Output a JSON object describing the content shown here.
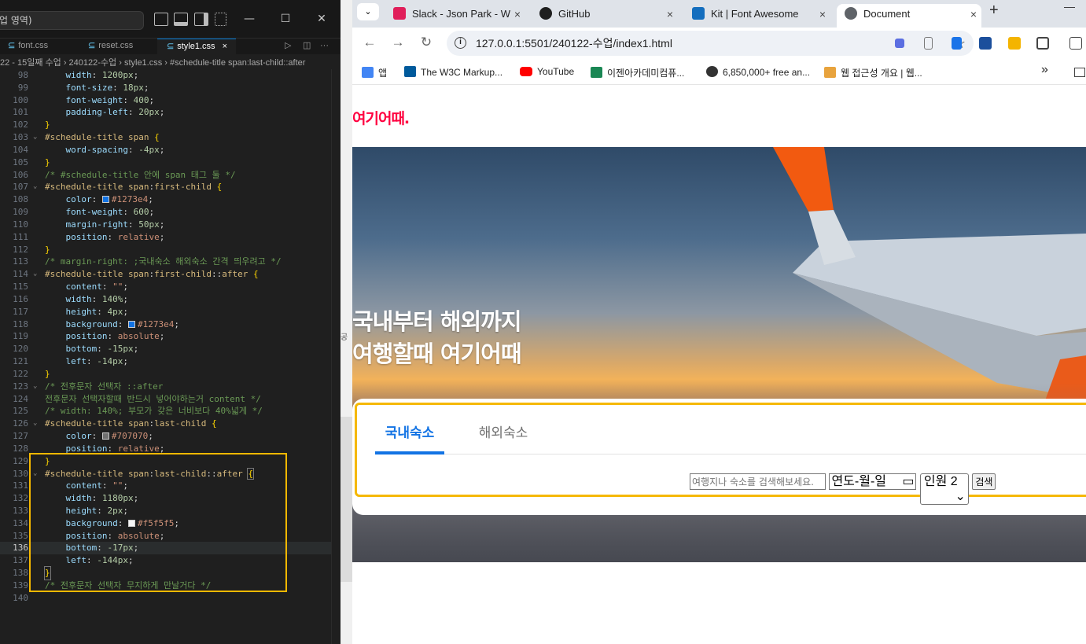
{
  "vscode": {
    "search_text": "업 영역)",
    "tabs": [
      {
        "label": "font.css"
      },
      {
        "label": "reset.css"
      },
      {
        "label": "style1.css",
        "close": "×"
      }
    ],
    "breadcrumb": "22 - 15일째 수업 › 240122-수업 › style1.css › #schedule-title span:last-child::after",
    "current_line": 136,
    "lines": [
      {
        "n": "98",
        "t": "    width: 1200px;"
      },
      {
        "n": "99",
        "t": "    font-size: 18px;"
      },
      {
        "n": "100",
        "t": "    font-weight: 400;"
      },
      {
        "n": "101",
        "t": "    padding-left: 20px;"
      },
      {
        "n": "102",
        "t": "}"
      },
      {
        "n": "103",
        "t": "#schedule-title span {"
      },
      {
        "n": "104",
        "t": "    word-spacing: -4px;"
      },
      {
        "n": "105",
        "t": "}"
      },
      {
        "n": "106",
        "t": "/* #schedule-title 안에 span 태그 둘 */"
      },
      {
        "n": "107",
        "t": "#schedule-title span:first-child {"
      },
      {
        "n": "108",
        "t": "    color: #1273e4;"
      },
      {
        "n": "109",
        "t": "    font-weight: 600;"
      },
      {
        "n": "110",
        "t": "    margin-right: 50px;"
      },
      {
        "n": "111",
        "t": "    position: relative;"
      },
      {
        "n": "112",
        "t": "}"
      },
      {
        "n": "113",
        "t": "/* margin-right: ;국내숙소 해외숙소 간격 띄우려고 */"
      },
      {
        "n": "114",
        "t": "#schedule-title span:first-child::after {"
      },
      {
        "n": "115",
        "t": "    content: \"\";"
      },
      {
        "n": "116",
        "t": "    width: 140%;"
      },
      {
        "n": "117",
        "t": "    height: 4px;"
      },
      {
        "n": "118",
        "t": "    background: #1273e4;"
      },
      {
        "n": "119",
        "t": "    position: absolute;"
      },
      {
        "n": "120",
        "t": "    bottom: -15px;"
      },
      {
        "n": "121",
        "t": "    left: -14px;"
      },
      {
        "n": "122",
        "t": "}"
      },
      {
        "n": "123",
        "t": "/* 전후문자 선택자 ::after"
      },
      {
        "n": "124",
        "t": "전후문자 선택자할때 반드시 넣어야하는거 content */"
      },
      {
        "n": "125",
        "t": "/* width: 140%; 부모가 갖은 너비보다 40%넓게 */"
      },
      {
        "n": "126",
        "t": "#schedule-title span:last-child {"
      },
      {
        "n": "127",
        "t": "    color: #707070;"
      },
      {
        "n": "128",
        "t": "    position: relative;"
      },
      {
        "n": "129",
        "t": "}"
      },
      {
        "n": "130",
        "t": "#schedule-title span:last-child::after {"
      },
      {
        "n": "131",
        "t": "    content: \"\";"
      },
      {
        "n": "132",
        "t": "    width: 1180px;"
      },
      {
        "n": "133",
        "t": "    height: 2px;"
      },
      {
        "n": "134",
        "t": "    background: #f5f5f5;"
      },
      {
        "n": "135",
        "t": "    position: absolute;"
      },
      {
        "n": "136",
        "t": "    bottom: -17px;"
      },
      {
        "n": "137",
        "t": "    left: -144px;"
      },
      {
        "n": "138",
        "t": "}"
      },
      {
        "n": "139",
        "t": "/* 전후문자 선택자 무지하게 만날거다 */"
      },
      {
        "n": "140",
        "t": ""
      }
    ],
    "gap_text": "공"
  },
  "chrome": {
    "tabs": [
      {
        "label": "Slack - Json Park - W",
        "icon_color": "#e01e5a",
        "close": "×"
      },
      {
        "label": "GitHub",
        "icon_color": "#1f1f1f",
        "close": "×"
      },
      {
        "label": "Kit | Font Awesome",
        "icon_color": "#146ebe",
        "close": "×"
      },
      {
        "label": "Document",
        "icon_color": "#5f6368",
        "close": "×"
      }
    ],
    "new_tab": "+",
    "minimize": "—",
    "url": "127.0.0.1:5501/240122-수업/index1.html",
    "bookmarks": [
      {
        "label": "앱",
        "icon_color": "#4285f4"
      },
      {
        "label": "The W3C Markup...",
        "icon_color": "#005a9c"
      },
      {
        "label": "YouTube",
        "icon_color": "#ff0000"
      },
      {
        "label": "이젠아카데미컴퓨...",
        "icon_color": "#1a8754"
      },
      {
        "label": "6,850,000+ free an...",
        "icon_color": "#333333"
      },
      {
        "label": "웹 접근성 개요 | 웹...",
        "icon_color": "#e8a33d"
      }
    ],
    "more_bookmarks": "»"
  },
  "site": {
    "logo": "여기어때.",
    "hero_line1": "국내부터 해외까지",
    "hero_line2": "여행할때 여기어때",
    "tab_domestic": "국내숙소",
    "tab_overseas": "해외숙소",
    "search_placeholder": "여행지나 숙소를 검색해보세요.",
    "date_value": "연도-월-일",
    "people_selected": "인원 2",
    "search_button": "검색",
    "accent_color": "#1273e4",
    "inactive_color": "#707070"
  }
}
